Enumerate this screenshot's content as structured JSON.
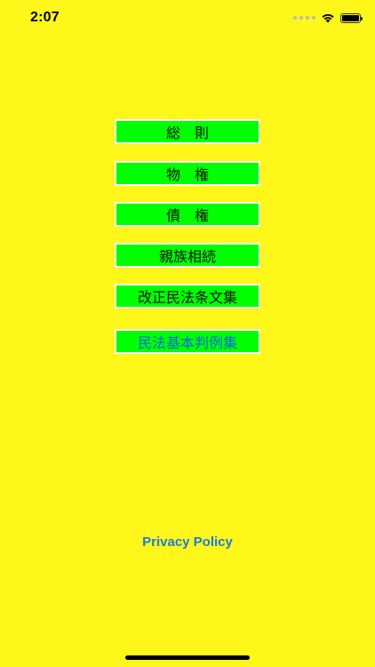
{
  "status_bar": {
    "time": "2:07",
    "wifi_icon": "wifi-icon",
    "battery_icon": "battery-icon",
    "signal_icon": "cellular-dots-icon"
  },
  "menu": {
    "items": [
      {
        "label": "総　則"
      },
      {
        "label": "物　権"
      },
      {
        "label": "債　権"
      },
      {
        "label": "親族相続"
      },
      {
        "label": "改正民法条文集"
      },
      {
        "label": "民法基本判例集"
      }
    ]
  },
  "footer": {
    "privacy_label": "Privacy Policy"
  },
  "colors": {
    "background": "#FFF61A",
    "button_fill": "#00FF00",
    "button_border": "#FFFFFF",
    "link": "#1E7BDC",
    "case_label": "#1565E6"
  }
}
